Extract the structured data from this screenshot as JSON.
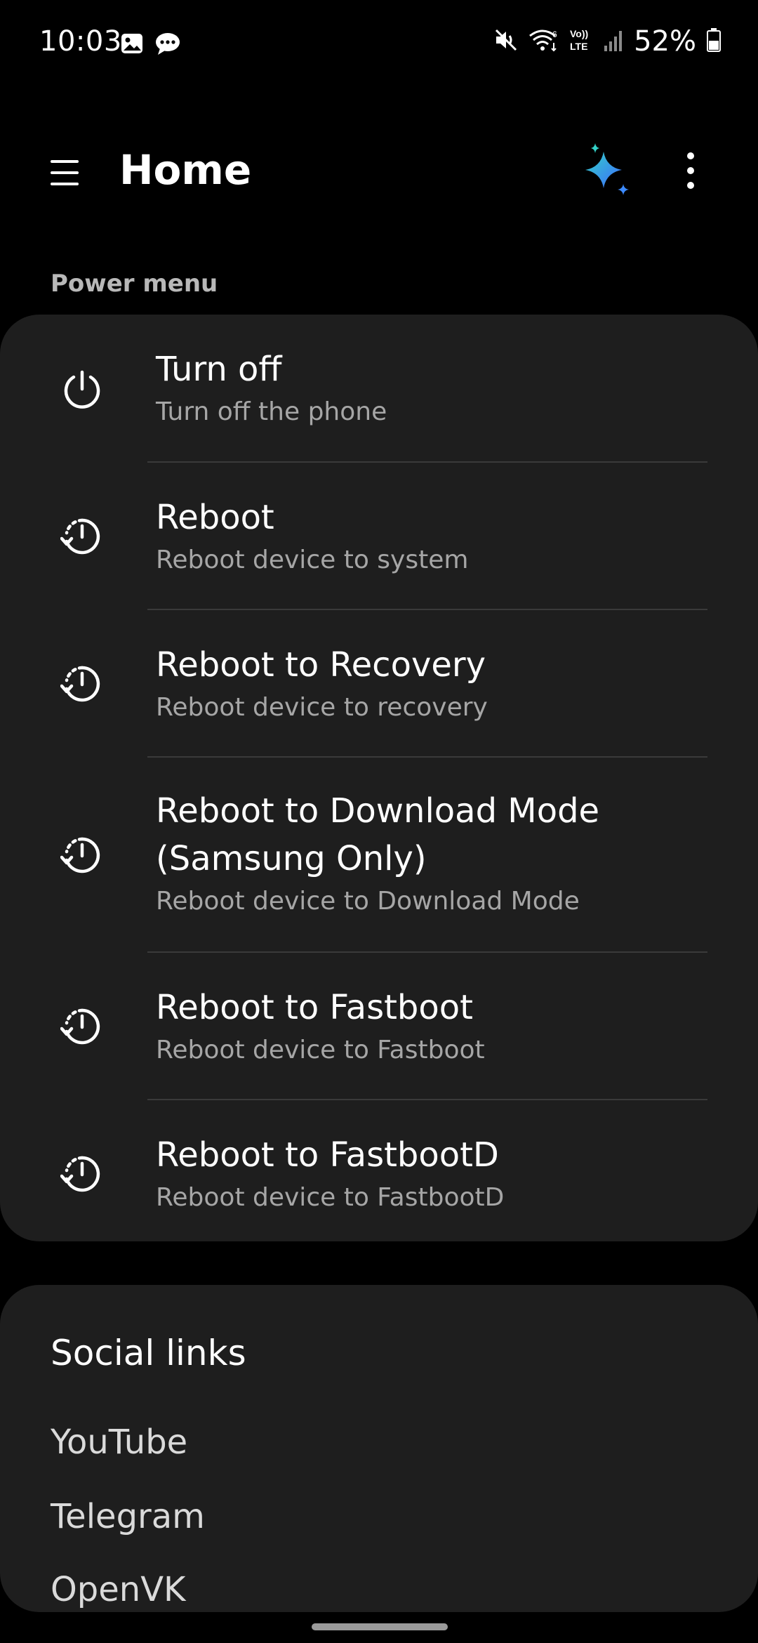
{
  "status_bar": {
    "time": "10:03",
    "battery_percent": "52%",
    "battery_level": 0.52,
    "icons_left": [
      "gallery-icon",
      "chat-icon"
    ],
    "icons_right": [
      "mute-icon",
      "wifi-icon",
      "volte-icon",
      "signal-icon",
      "battery-icon"
    ],
    "wifi_label": "6",
    "volte_top": "Vo))",
    "volte_bottom": "LTE"
  },
  "app_bar": {
    "title": "Home",
    "menu_icon": "hamburger-menu-icon",
    "sparkle_icon": "ai-sparkle-icon",
    "more_icon": "more-vert-icon"
  },
  "power_menu": {
    "header": "Power menu",
    "items": [
      {
        "title": "Turn off",
        "subtitle": "Turn off the phone",
        "icon": "power-icon"
      },
      {
        "title": "Reboot",
        "subtitle": "Reboot device to system",
        "icon": "restart-icon"
      },
      {
        "title": "Reboot to Recovery",
        "subtitle": "Reboot device to recovery",
        "icon": "restart-icon"
      },
      {
        "title_line1": "Reboot to Download Mode",
        "title_line2": "(Samsung Only)",
        "subtitle": "Reboot device to Download Mode",
        "icon": "restart-icon"
      },
      {
        "title": "Reboot to Fastboot",
        "subtitle": "Reboot device to Fastboot",
        "icon": "restart-icon"
      },
      {
        "title": "Reboot to FastbootD",
        "subtitle": "Reboot device to FastbootD",
        "icon": "restart-icon"
      }
    ]
  },
  "social_links": {
    "title": "Social links",
    "links": [
      "YouTube",
      "Telegram",
      "OpenVK"
    ]
  },
  "colors": {
    "background": "#000000",
    "card": "#1e1e1e",
    "divider": "#3a3a3a",
    "subtitle": "#a6a6a6",
    "accent_blue": "#3d8bff",
    "accent_teal": "#33d1c7"
  }
}
